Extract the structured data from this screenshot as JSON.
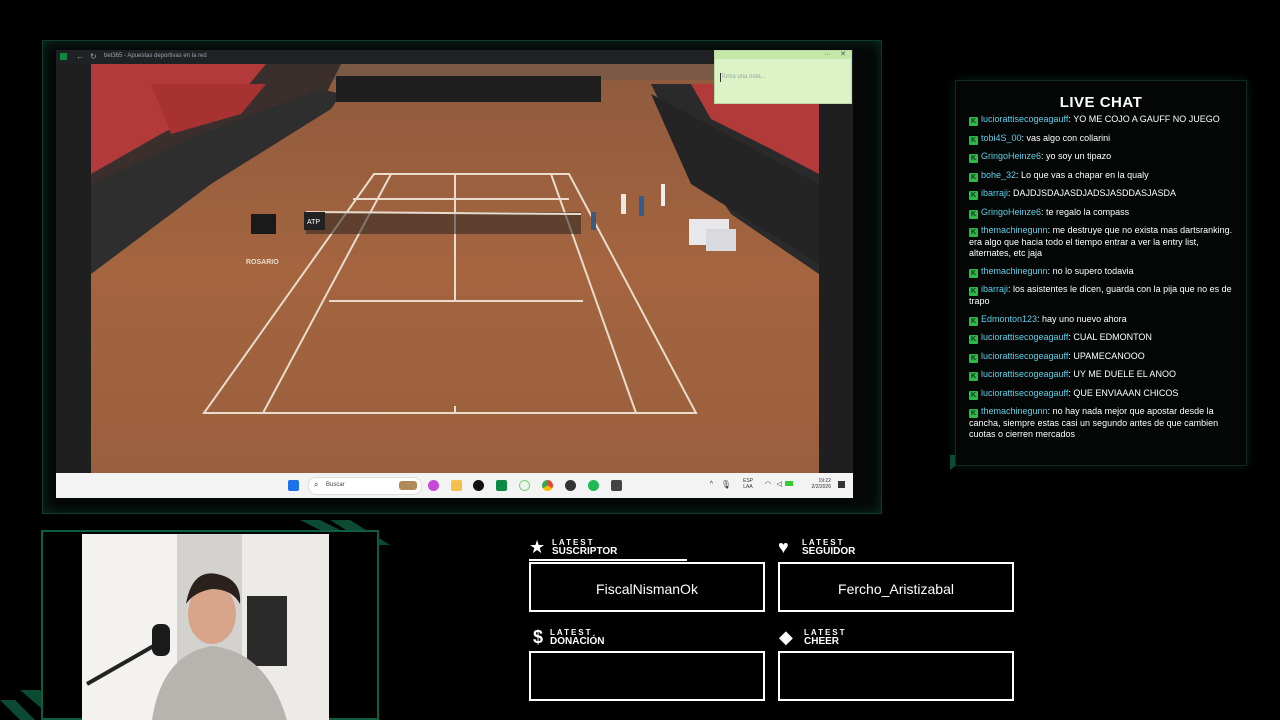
{
  "browser": {
    "title": "bet365 - Apuestas deportivas en la red"
  },
  "court": {
    "sponsor_text": "ROSARIO",
    "net_brand": "ATP"
  },
  "sticky_note": {
    "placeholder": "Toma una nota...",
    "menu_glyph": "···",
    "close_glyph": "✕"
  },
  "taskbar": {
    "search_label": "Buscar",
    "language_line1": "ESP",
    "language_line2": "LAA",
    "time": "19:22",
    "date": "2/2/2026"
  },
  "chat": {
    "title": "LIVE CHAT",
    "messages": [
      {
        "user": "luciorattisecogeagauff",
        "text": ": YO ME COJO A GAUFF NO JUEGO"
      },
      {
        "user": "tobi4S_00",
        "text": ": vas algo con collarini"
      },
      {
        "user": "GringoHeinze6",
        "text": ": yo soy un tipazo"
      },
      {
        "user": "bohe_32",
        "text": ": Lo que vas a chapar en la qualy"
      },
      {
        "user": "ibarraji",
        "text": ": DAJDJSDAJASDJADSJASDDASJASDA"
      },
      {
        "user": "GringoHeinze6",
        "text": ": te regalo la compass"
      },
      {
        "user": "themachinegunn",
        "text": ": me destruye que no exista mas dartsranking. era algo que hacia todo el tiempo entrar a ver la entry list, alternates, etc jaja"
      },
      {
        "user": "themachinegunn",
        "text": ": no lo supero todavia"
      },
      {
        "user": "ibarraji",
        "text": ": los asistentes le dicen, guarda con la pija que no es de trapo"
      },
      {
        "user": "Edmonton123",
        "text": ": hay uno nuevo ahora"
      },
      {
        "user": "luciorattisecogeagauff",
        "text": ": CUAL EDMONTON"
      },
      {
        "user": "luciorattisecogeagauff",
        "text": ": UPAMECANOOO"
      },
      {
        "user": "luciorattisecogeagauff",
        "text": ": UY ME DUELE EL ANOO"
      },
      {
        "user": "luciorattisecogeagauff",
        "text": ": QUE ENVIAAAN CHICOS"
      },
      {
        "user": "themachinegunn",
        "text": ": no hay nada mejor que apostar desde la cancha, siempre estas casi un segundo antes de que cambien cuotas o cierren mercados"
      }
    ]
  },
  "latest": {
    "suscriptor": {
      "top": "LATEST",
      "label": "SUSCRIPTOR",
      "value": "FiscalNismanOk"
    },
    "seguidor": {
      "top": "LATEST",
      "label": "SEGUIDOR",
      "value": "Fercho_Aristizabal"
    },
    "donacion": {
      "top": "LATEST",
      "label": "DONACIÓN",
      "value": ""
    },
    "cheer": {
      "top": "LATEST",
      "label": "CHEER",
      "value": ""
    }
  },
  "colors": {
    "accent_green": "#0f5c40",
    "chat_username": "#5fd0e8",
    "clay": "#b9704a"
  }
}
